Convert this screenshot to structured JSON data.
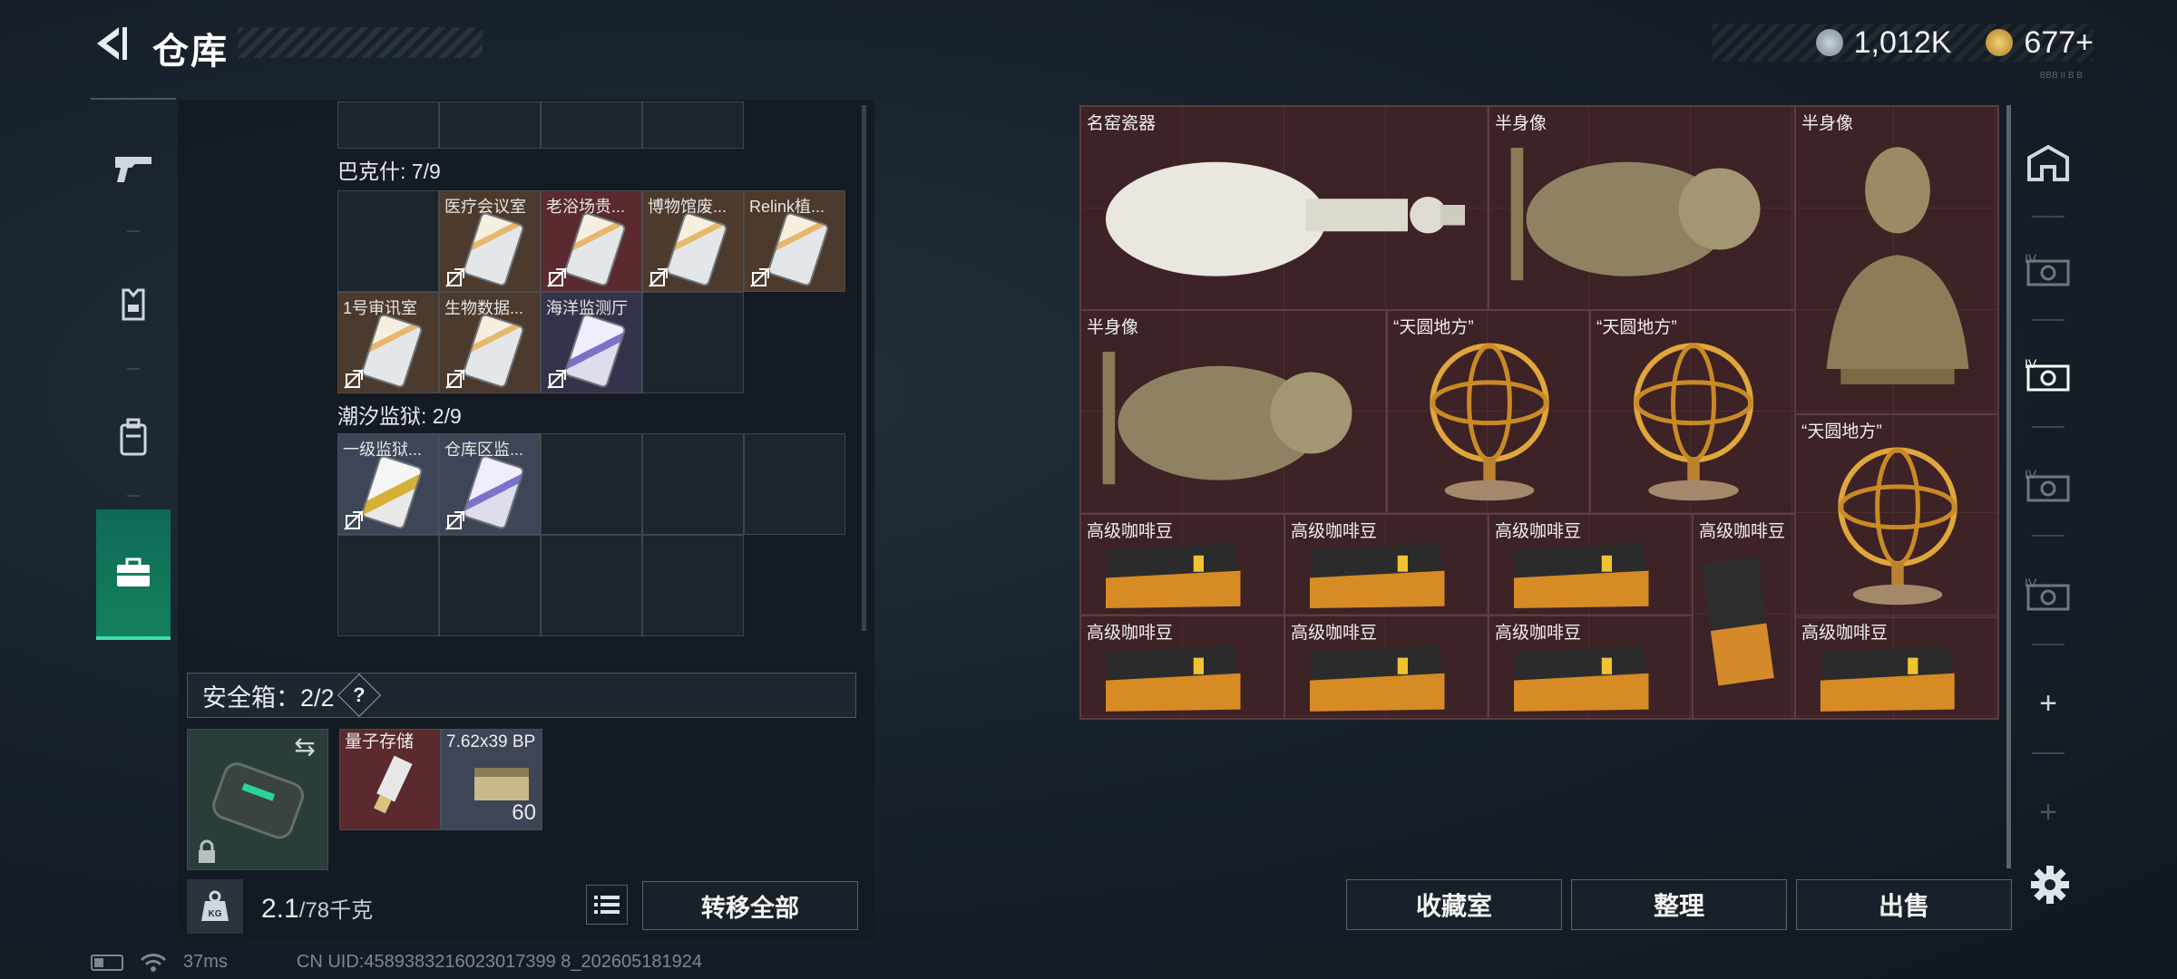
{
  "header": {
    "title": "仓库",
    "currency_a": "1,012K",
    "currency_b": "677+",
    "build_tag": "BBB II B B"
  },
  "left_nav": [
    "gun-icon",
    "armor-icon",
    "backpack-icon",
    "case-icon"
  ],
  "stash_sections": [
    {
      "label": "巴克什: 7/9",
      "items": [
        {
          "label": "医疗会议室",
          "bg": "brown",
          "card": "gold"
        },
        {
          "label": "老浴场贵...",
          "bg": "red",
          "card": "gold"
        },
        {
          "label": "博物馆废...",
          "bg": "brown",
          "card": "gold"
        },
        {
          "label": "Relink植...",
          "bg": "brown",
          "card": "gold"
        },
        {
          "label": "1号审讯室",
          "bg": "brown",
          "card": "gold"
        },
        {
          "label": "生物数据...",
          "bg": "brown",
          "card": "gold"
        },
        {
          "label": "海洋监测厅",
          "bg": "navy",
          "card": "purple"
        }
      ]
    },
    {
      "label": "潮汐监狱: 2/9",
      "items": [
        {
          "label": "一级监狱...",
          "bg": "blue",
          "card": "yel"
        },
        {
          "label": "仓库区监...",
          "bg": "blue",
          "card": "purple"
        }
      ]
    }
  ],
  "safe_box": {
    "label": "安全箱：2/2",
    "help": "?",
    "items": [
      {
        "label": "量子存储",
        "bg": "red"
      },
      {
        "label": "7.62x39 BP",
        "count": "60",
        "bg": "blue"
      }
    ]
  },
  "weight": {
    "current": "2.1",
    "capacity": "/78千克"
  },
  "transfer_all": "转移全部",
  "stash_grid": {
    "items": [
      {
        "label": "名窑瓷器",
        "kind": "vase"
      },
      {
        "label": "半身像",
        "kind": "bust-side"
      },
      {
        "label": "半身像",
        "kind": "bust-front"
      },
      {
        "label": "半身像",
        "kind": "bust-side"
      },
      {
        "label": "“天圆地方”",
        "kind": "globe"
      },
      {
        "label": "“天圆地方”",
        "kind": "globe"
      },
      {
        "label": "“天圆地方”",
        "kind": "globe"
      },
      {
        "label": "高级咖啡豆",
        "kind": "coffee"
      },
      {
        "label": "高级咖啡豆",
        "kind": "coffee"
      },
      {
        "label": "高级咖啡豆",
        "kind": "coffee"
      },
      {
        "label": "高级咖啡豆",
        "kind": "coffee-tall"
      },
      {
        "label": "高级咖啡豆",
        "kind": "coffee"
      },
      {
        "label": "高级咖啡豆",
        "kind": "coffee"
      },
      {
        "label": "高级咖啡豆",
        "kind": "coffee"
      },
      {
        "label": "高级咖啡豆",
        "kind": "coffee"
      }
    ]
  },
  "right_nav": {
    "add_1": "+",
    "add_2": "+",
    "tier": "IV"
  },
  "buttons": {
    "collect": "收藏室",
    "sort": "整理",
    "sell": "出售"
  },
  "footer": {
    "ping": "37ms",
    "uid": "CN UID:4589383216023017399 8_202605181924"
  },
  "colors": {
    "accent": "#3fe0a8",
    "stash_bg": "#3d2226",
    "panel_bg": "#131a21"
  }
}
